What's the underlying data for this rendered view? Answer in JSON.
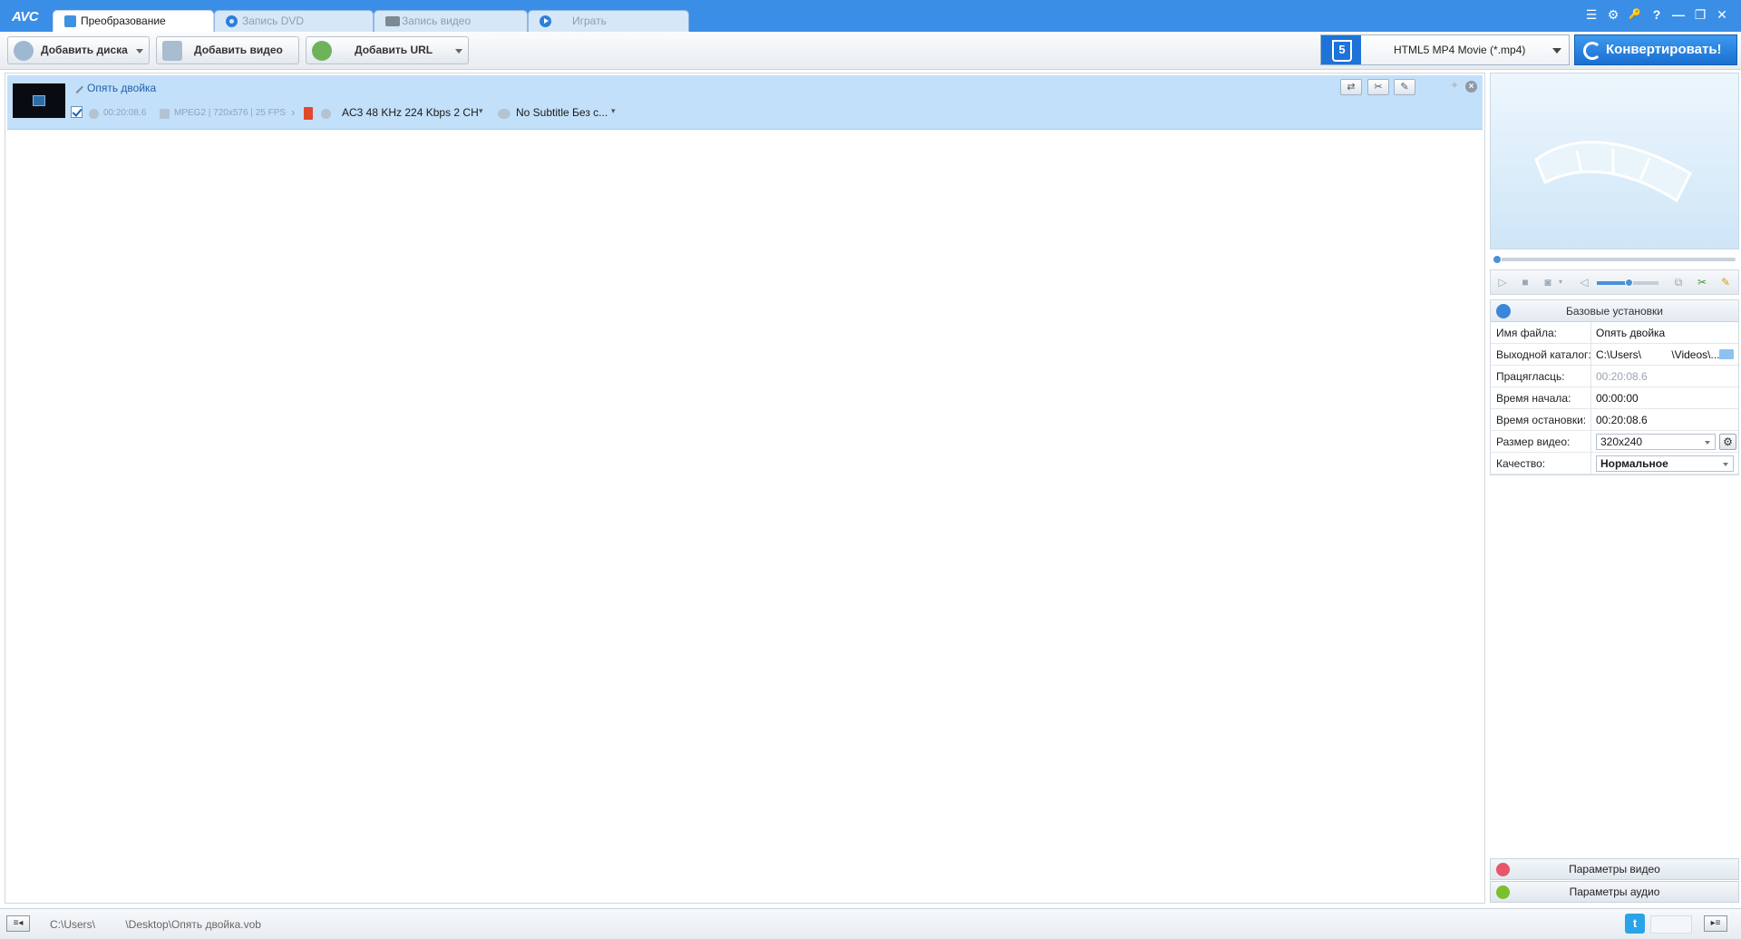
{
  "app": {
    "logo": "AVC"
  },
  "tabs": [
    {
      "label": "Преобразование",
      "active": true
    },
    {
      "label": "Запись DVD",
      "active": false
    },
    {
      "label": "Запись видео",
      "active": false
    },
    {
      "label": "Играть",
      "active": false
    }
  ],
  "window_controls": {
    "menu": "☰",
    "settings": "⚙",
    "key": "🔑",
    "help": "?",
    "minimize": "—",
    "restore": "❐",
    "close": "✕"
  },
  "toolbar": {
    "add_disc": "Добавить диска",
    "add_video": "Добавить видео",
    "add_url": "Добавить URL",
    "format": "HTML5 MP4 Movie (*.mp4)",
    "convert": "Конвертировать!"
  },
  "file": {
    "title": "Опять двойка",
    "duration": "00:20:08.6",
    "video_info": "MPEG2 | 720x576 | 25 FPS",
    "audio": "AC3 48 KHz 224 Kbps 2 CH",
    "subtitle": "No Subtitle Без с...",
    "checked": true
  },
  "settings": {
    "header": "Базовые установки",
    "rows": [
      {
        "label": "Имя файла:",
        "value": "Опять двойка"
      },
      {
        "label": "Выходной каталог:",
        "value": "C:\\Users\\          \\Videos\\..."
      },
      {
        "label": "Працягласць:",
        "value": "00:20:08.6"
      },
      {
        "label": "Время начала:",
        "value": "00:00:00"
      },
      {
        "label": "Время остановки:",
        "value": "00:20:08.6"
      },
      {
        "label": "Размер видео:",
        "value": "320x240"
      },
      {
        "label": "Качество:",
        "value": "Нормальное"
      }
    ]
  },
  "panels": {
    "video_params": "Параметры видео",
    "audio_params": "Параметры аудио"
  },
  "status": {
    "path": "C:\\Users\\          \\Desktop\\Опять двойка.vob",
    "twitter": "t"
  },
  "colors": {
    "titlebar": "#3a8ee6",
    "accent": "#1e73d8",
    "row_selected": "#c3e0fa"
  }
}
